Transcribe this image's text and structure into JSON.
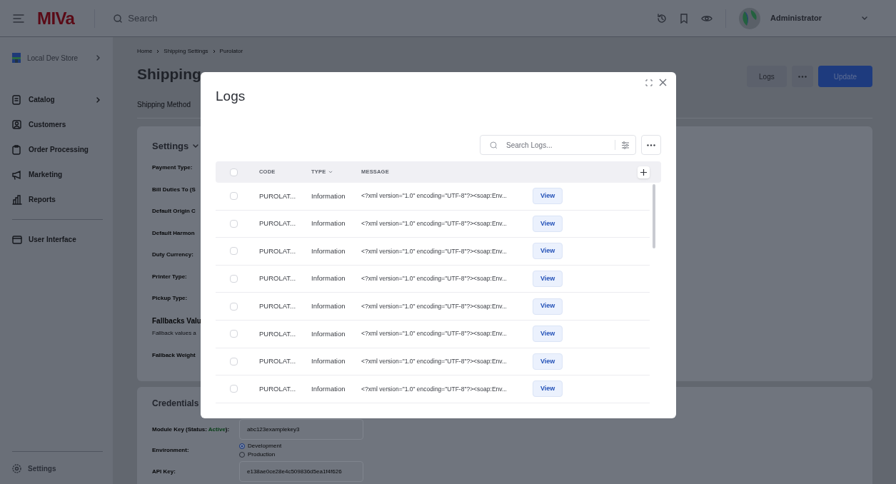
{
  "topbar": {
    "logo": "MIVa",
    "search_placeholder": "Search",
    "user": "Administrator"
  },
  "sidebar": {
    "store": "Local Dev Store",
    "items": [
      {
        "kind": "catalog",
        "label": "Catalog",
        "has_children": true
      },
      {
        "kind": "customers",
        "label": "Customers",
        "has_children": false
      },
      {
        "kind": "orders",
        "label": "Order Processing",
        "has_children": false
      },
      {
        "kind": "marketing",
        "label": "Marketing",
        "has_children": false
      },
      {
        "kind": "reports",
        "label": "Reports",
        "has_children": false
      },
      {
        "kind": "divider"
      },
      {
        "kind": "ui",
        "label": "User Interface",
        "has_children": false
      }
    ],
    "footer": "Settings"
  },
  "page": {
    "breadcrumb": [
      "Home",
      "Shipping Settings",
      "Purolator"
    ],
    "title": "Shipping",
    "tab": "Shipping Method",
    "buttons": {
      "logs": "Logs",
      "update": "Update"
    }
  },
  "settings_card": {
    "title": "Settings",
    "rows": [
      {
        "kind": "label",
        "text": "Payment Type:"
      },
      {
        "kind": "label",
        "text": "Bill Duties To (S"
      },
      {
        "kind": "label",
        "text": "Default Origin C"
      },
      {
        "kind": "label",
        "text": "Default Harmon"
      },
      {
        "kind": "label",
        "text": "Duty Currency:"
      },
      {
        "kind": "label",
        "text": "Printer Type:"
      },
      {
        "kind": "label",
        "text": "Pickup Type:"
      },
      {
        "kind": "heading",
        "text": "Fallbacks Valu",
        "note": "Fallback values a"
      },
      {
        "kind": "label",
        "text": "Fallback Weight"
      }
    ]
  },
  "credentials_card": {
    "title": "Credentials",
    "module_key": {
      "label": "Module Key (Status: ",
      "status": "Active",
      "suffix": "):",
      "value": "abc123examplekey3"
    },
    "environment": {
      "label": "Environment:",
      "options": [
        {
          "label": "Development",
          "selected": true
        },
        {
          "label": "Production",
          "selected": false
        }
      ]
    },
    "api_key": {
      "label": "API Key:",
      "value": "e138ae0ce28e4c509836d5ea1f4f626"
    }
  },
  "modal": {
    "title": "Logs",
    "search_placeholder": "Search Logs...",
    "all_checked": false,
    "columns": [
      {
        "label": "CODE",
        "sortable": false
      },
      {
        "label": "TYPE",
        "sortable": true
      },
      {
        "label": "MESSAGE",
        "sortable": false
      }
    ],
    "rows": [
      {
        "checked": false,
        "code": "PUROLAT...",
        "type": "Information",
        "message": "<?xml version=\"1.0\" encoding=\"UTF-8\"?><soap:Env...",
        "action": "View"
      },
      {
        "checked": false,
        "code": "PUROLAT...",
        "type": "Information",
        "message": "<?xml version=\"1.0\" encoding=\"UTF-8\"?><soap:Env...",
        "action": "View"
      },
      {
        "checked": false,
        "code": "PUROLAT...",
        "type": "Information",
        "message": "<?xml version=\"1.0\" encoding=\"UTF-8\"?><soap:Env...",
        "action": "View"
      },
      {
        "checked": false,
        "code": "PUROLAT...",
        "type": "Information",
        "message": "<?xml version=\"1.0\" encoding=\"UTF-8\"?><soap:Env...",
        "action": "View"
      },
      {
        "checked": false,
        "code": "PUROLAT...",
        "type": "Information",
        "message": "<?xml version=\"1.0\" encoding=\"UTF-8\"?><soap:Env...",
        "action": "View"
      },
      {
        "checked": false,
        "code": "PUROLAT...",
        "type": "Information",
        "message": "<?xml version=\"1.0\" encoding=\"UTF-8\"?><soap:Env...",
        "action": "View"
      },
      {
        "checked": false,
        "code": "PUROLAT...",
        "type": "Information",
        "message": "<?xml version=\"1.0\" encoding=\"UTF-8\"?><soap:Env...",
        "action": "View"
      },
      {
        "checked": false,
        "code": "PUROLAT...",
        "type": "Information",
        "message": "<?xml version=\"1.0\" encoding=\"UTF-8\"?><soap:Env...",
        "action": "View"
      }
    ]
  }
}
